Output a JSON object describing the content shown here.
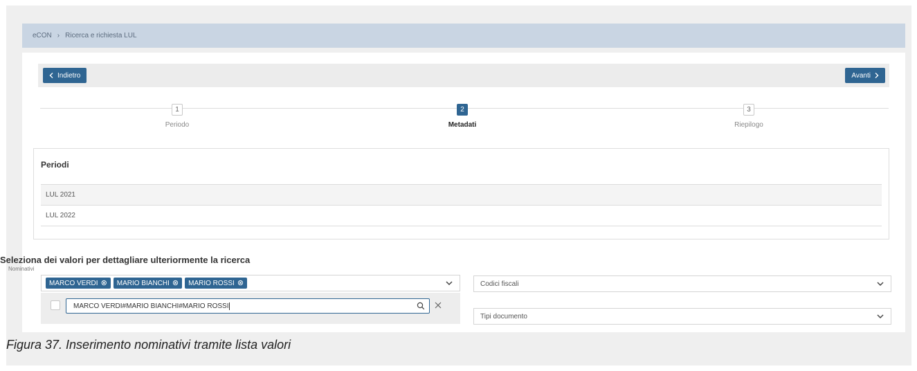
{
  "breadcrumb": {
    "root": "eCON",
    "separator": "›",
    "current": "Ricerca e richiesta LUL"
  },
  "nav": {
    "back_label": "Indietro",
    "back_icon": "chevron-left-icon",
    "next_label": "Avanti",
    "next_icon": "chevron-right-icon"
  },
  "stepper": {
    "steps": [
      {
        "number": "1",
        "label": "Periodo",
        "active": false
      },
      {
        "number": "2",
        "label": "Metadati",
        "active": true
      },
      {
        "number": "3",
        "label": "Riepilogo",
        "active": false
      }
    ]
  },
  "periodi": {
    "title": "Periodi",
    "rows": [
      "LUL 2021",
      "LUL 2022"
    ]
  },
  "filters": {
    "heading": "Seleziona dei valori per dettagliare ulteriormente la ricerca",
    "nominativi_label": "Nominativi",
    "selected_tags": [
      "MARCO VERDI",
      "MARIO BIANCHI",
      "MARIO ROSSI"
    ],
    "search_value": "MARCO VERDI#MARIO BIANCHI#MARIO ROSSI",
    "codici_fiscali_placeholder": "Codici fiscali",
    "tipi_documento_placeholder": "Tipi documento"
  },
  "caption": "Figura 37. Inserimento nominativi tramite lista valori",
  "colors": {
    "primary": "#2f6592",
    "breadcrumb_bg": "#c9d5e3",
    "frame_bg": "#efefef"
  }
}
